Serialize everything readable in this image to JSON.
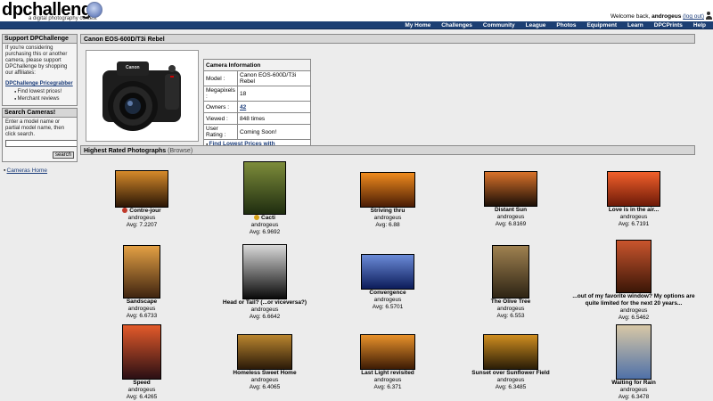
{
  "header": {
    "logo": "dpchallenge",
    "tagline": "a digital photography contest",
    "welcome_prefix": "Welcome back,",
    "username": "androgeus",
    "logout": "(log out)"
  },
  "nav": [
    "My Home",
    "Challenges",
    "Community",
    "League",
    "Photos",
    "Equipment",
    "Learn",
    "DPCPrints",
    "Help"
  ],
  "sidebar": {
    "support": {
      "title": "Support DPChallenge",
      "text": "If you're considering purchasing this or another camera, please support DPChallenge by shopping our affiliates:",
      "link": "DPChallenge Pricegrabber",
      "bullets": [
        "Find lowest prices!",
        "Merchant reviews"
      ]
    },
    "search": {
      "title": "Search Cameras!",
      "text": "Enter a model name or partial model name, then click search.",
      "button": "search",
      "value": ""
    },
    "cameras_home": "Cameras Home"
  },
  "camera": {
    "title": "Canon EOS-600D/T3i Rebel",
    "info_header": "Camera Information",
    "rows": [
      {
        "label": "Model :",
        "value": "Canon EOS-600D/T3i Rebel"
      },
      {
        "label": "Megapixels :",
        "value": "18"
      },
      {
        "label": "Owners :",
        "value": "42"
      },
      {
        "label": "Viewed :",
        "value": "848 times"
      },
      {
        "label": "User Rating :",
        "value": "Coming Soon!"
      }
    ],
    "prices_link": "Find Lowest Prices with Pricegrabber!"
  },
  "gallery": {
    "title": "Highest Rated Photographs",
    "browse": "(Browse)",
    "photos": [
      {
        "title": "Contre-jour",
        "author": "androgeus",
        "avg": "Avg: 7.2207",
        "ribbon": "#c0392b"
      },
      {
        "title": "Cacti",
        "author": "androgeus",
        "avg": "Avg: 6.9692",
        "ribbon": "#d4a017"
      },
      {
        "title": "Striving thru",
        "author": "androgeus",
        "avg": "Avg: 6.88"
      },
      {
        "title": "Distant Sun",
        "author": "androgeus",
        "avg": "Avg: 6.8169"
      },
      {
        "title": "Love is in the air...",
        "author": "androgeus",
        "avg": "Avg: 6.7191"
      },
      {
        "title": "Sandscape",
        "author": "androgeus",
        "avg": "Avg: 6.6733"
      },
      {
        "title": "Head or Tail? (...or viceversa?)",
        "author": "androgeus",
        "avg": "Avg: 6.6642"
      },
      {
        "title": "Convergence",
        "author": "androgeus",
        "avg": "Avg: 6.5701"
      },
      {
        "title": "The Olive Tree",
        "author": "androgeus",
        "avg": "Avg: 6.553"
      },
      {
        "title": "...out of my favorite window? My options are quite limited for the next 20 years...",
        "author": "androgeus",
        "avg": "Avg: 6.5462"
      },
      {
        "title": "Speed",
        "author": "androgeus",
        "avg": "Avg: 6.4265"
      },
      {
        "title": "Homeless Sweet Home",
        "author": "androgeus",
        "avg": "Avg: 6.4065"
      },
      {
        "title": "Last Light revisited",
        "author": "androgeus",
        "avg": "Avg: 6.371"
      },
      {
        "title": "Sunset over Sunflower Field",
        "author": "androgeus",
        "avg": "Avg: 6.3485"
      },
      {
        "title": "Waiting for Rain",
        "author": "androgeus",
        "avg": "Avg: 6.3478"
      }
    ]
  }
}
